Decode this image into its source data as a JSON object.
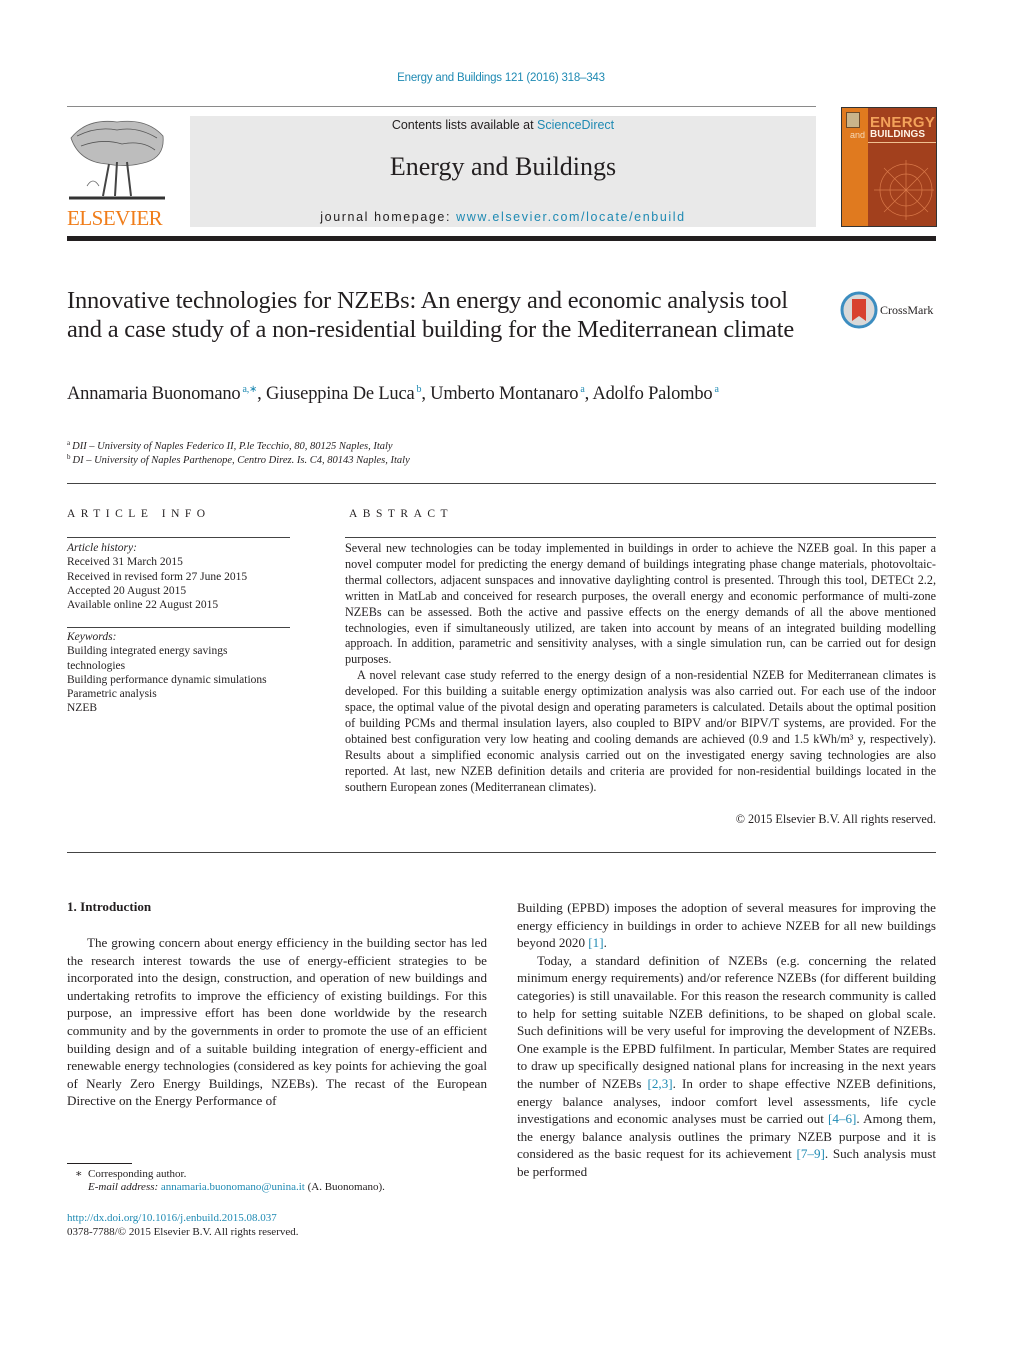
{
  "header": {
    "citation": "Energy and Buildings 121 (2016) 318–343",
    "contents_prefix": "Contents lists available at ",
    "contents_link": "ScienceDirect",
    "journal_title": "Energy and Buildings",
    "homepage_prefix": "journal homepage: ",
    "homepage_link": "www.elsevier.com/locate/enbuild",
    "publisher_logo_text": "ELSEVIER",
    "cover": {
      "title_line1": "ENERGY",
      "title_line2_prefix": "and",
      "title_line2": "BUILDINGS"
    },
    "colors": {
      "link": "#1f8ab3",
      "elsevier_orange": "#f07d1a",
      "banner_bg": "#e9e9e9",
      "cover_bg": "#a2401d",
      "cover_accent": "#e07a1f"
    }
  },
  "article": {
    "title": "Innovative technologies for NZEBs: An energy and economic analysis tool and a case study of a non-residential building for the Mediterranean climate",
    "crossmark_label": "CrossMark",
    "authors": [
      {
        "name": "Annamaria Buonomano",
        "sup": "a,∗"
      },
      {
        "name": "Giuseppina De Luca",
        "sup": "b"
      },
      {
        "name": "Umberto Montanaro",
        "sup": "a"
      },
      {
        "name": "Adolfo Palombo",
        "sup": "a"
      }
    ],
    "affiliations": [
      {
        "key": "a",
        "text": "DII – University of Naples Federico II, P.le Tecchio, 80, 80125 Naples, Italy"
      },
      {
        "key": "b",
        "text": "DI – University of Naples Parthenope, Centro Direz. Is. C4, 80143 Naples, Italy"
      }
    ]
  },
  "article_info": {
    "heading": "ARTICLE INFO",
    "history_label": "Article history:",
    "history": [
      "Received 31 March 2015",
      "Received in revised form 27 June 2015",
      "Accepted 20 August 2015",
      "Available online 22 August 2015"
    ],
    "keywords_label": "Keywords:",
    "keywords": [
      "Building integrated energy savings technologies",
      "Building performance dynamic simulations",
      "Parametric analysis",
      "NZEB"
    ]
  },
  "abstract": {
    "heading": "ABSTRACT",
    "paragraphs": [
      "Several new technologies can be today implemented in buildings in order to achieve the NZEB goal. In this paper a novel computer model for predicting the energy demand of buildings integrating phase change materials, photovoltaic-thermal collectors, adjacent sunspaces and innovative daylighting control is presented. Through this tool, DETECt 2.2, written in MatLab and conceived for research purposes, the overall energy and economic performance of multi-zone NZEBs can be assessed. Both the active and passive effects on the energy demands of all the above mentioned technologies, even if simultaneously utilized, are taken into account by means of an integrated building modelling approach. In addition, parametric and sensitivity analyses, with a single simulation run, can be carried out for design purposes.",
      "A novel relevant case study referred to the energy design of a non-residential NZEB for Mediterranean climates is developed. For this building a suitable energy optimization analysis was also carried out. For each use of the indoor space, the optimal value of the pivotal design and operating parameters is calculated. Details about the optimal position of building PCMs and thermal insulation layers, also coupled to BIPV and/or BIPV/T systems, are provided. For the obtained best configuration very low heating and cooling demands are achieved (0.9 and 1.5 kWh/m³ y, respectively). Results about a simplified economic analysis carried out on the investigated energy saving technologies are also reported. At last, new NZEB definition details and criteria are provided for non-residential buildings located in the southern European zones (Mediterranean climates)."
    ],
    "copyright": "© 2015 Elsevier B.V. All rights reserved."
  },
  "body": {
    "section_heading": "1.  Introduction",
    "left_paragraph": "The growing concern about energy efficiency in the building sector has led the research interest towards the use of energy-efficient strategies to be incorporated into the design, construction, and operation of new buildings and undertaking retrofits to improve the efficiency of existing buildings. For this purpose, an impressive effort has been done worldwide by the research community and by the governments in order to promote the use of an efficient building design and of a suitable building integration of energy-efficient and renewable energy technologies (considered as key points for achieving the goal of Nearly Zero Energy Buildings, NZEBs). The recast of the European Directive on the Energy Performance of",
    "right_p1": {
      "text": "Building (EPBD) imposes the adoption of several measures for improving the energy efficiency in buildings in order to achieve NZEB for all new buildings beyond 2020 ",
      "ref": "[1]",
      "end": "."
    },
    "right_p2": {
      "t1": "Today, a standard definition of NZEBs (e.g. concerning the related minimum energy requirements) and/or reference NZEBs (for different building categories) is still unavailable. For this reason the research community is called to help for setting suitable NZEB definitions, to be shaped on global scale. Such definitions will be very useful for improving the development of NZEBs. One example is the EPBD fulfilment. In particular, Member States are required to draw up specifically designed national plans for increasing in the next years the number of NZEBs ",
      "r1": "[2,3]",
      "t2": ". In order to shape effective NZEB definitions, energy balance analyses, indoor comfort level assessments, life cycle investigations and economic analyses must be carried out ",
      "r2": "[4–6]",
      "t3": ". Among them, the energy balance analysis outlines the primary NZEB purpose and it is considered as the basic request for its achievement ",
      "r3": "[7–9]",
      "t4": ". Such analysis must be performed"
    }
  },
  "footnotes": {
    "corresponding_mark": "∗",
    "corresponding_text": "Corresponding author.",
    "email_label": "E-mail address: ",
    "email": "annamaria.buonomano@unina.it",
    "email_suffix": " (A. Buonomano).",
    "doi_link": "http://dx.doi.org/10.1016/j.enbuild.2015.08.037",
    "issn_line": "0378-7788/© 2015 Elsevier B.V. All rights reserved."
  }
}
